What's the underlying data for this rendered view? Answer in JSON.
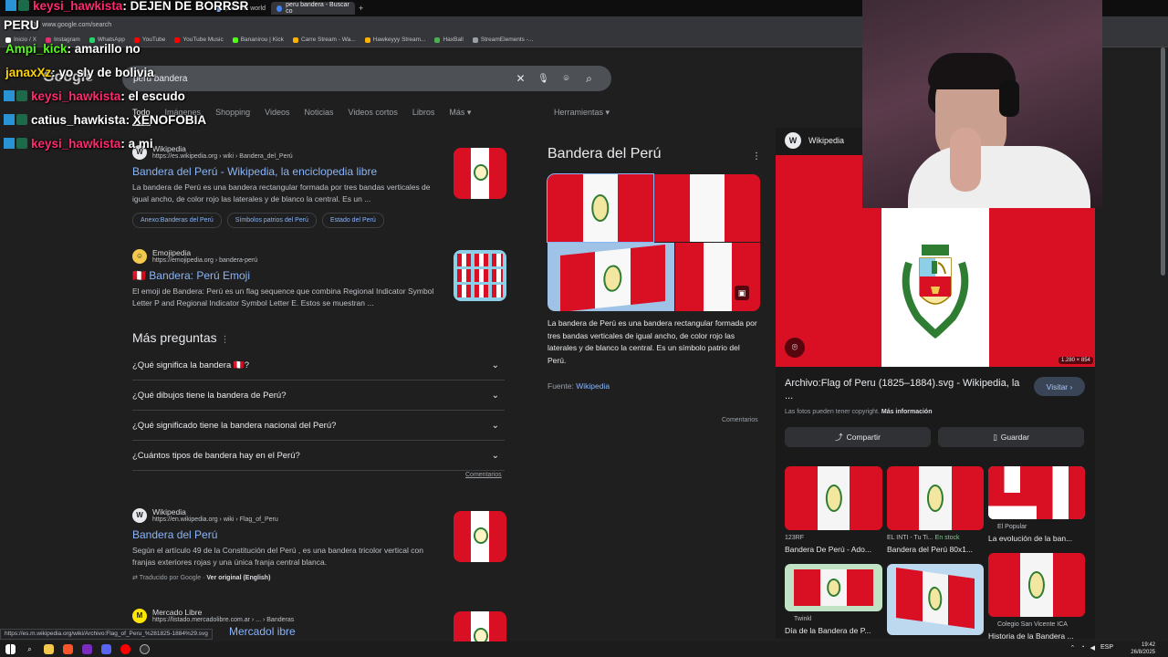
{
  "browser": {
    "tabs": [
      {
        "label": "print the world",
        "active": false
      },
      {
        "label": "peru bandera - Buscar co",
        "active": true
      }
    ],
    "new_tab": "+",
    "url": "www.google.com/search",
    "bookmarks": [
      {
        "label": "Inicio / X",
        "color": "#ffffff"
      },
      {
        "label": "Instagram",
        "color": "#e1306c"
      },
      {
        "label": "WhatsApp",
        "color": "#25d366"
      },
      {
        "label": "YouTube",
        "color": "#ff0000"
      },
      {
        "label": "YouTube Music",
        "color": "#ff0000"
      },
      {
        "label": "Bananirou | Kick",
        "color": "#53fc18"
      },
      {
        "label": "Carre Stream - Wa...",
        "color": "#ffb300"
      },
      {
        "label": "Hawkeyyy Stream...",
        "color": "#ffb300"
      },
      {
        "label": "HaxBall",
        "color": "#4caf50"
      },
      {
        "label": "StreamElements -...",
        "color": "#9aa0a6"
      }
    ]
  },
  "search": {
    "logo": "Google",
    "query": "peru bandera",
    "tabs": [
      "Todo",
      "Imágenes",
      "Shopping",
      "Videos",
      "Noticias",
      "Videos cortos",
      "Libros",
      "Más ▾"
    ],
    "tools": "Herramientas ▾"
  },
  "results": [
    {
      "source": "Wikipedia",
      "url": "https://es.wikipedia.org › wiki › Bandera_del_Perú",
      "title": "Bandera del Perú - Wikipedia, la enciclopedia libre",
      "snippet": "La bandera de Perú es una bandera rectangular formada por tres bandas verticales de igual ancho, de color rojo las laterales y de blanco la central. Es un ...",
      "chips": [
        "Anexo:Banderas del Perú",
        "Símbolos patrios del Perú",
        "Estado del Perú"
      ]
    },
    {
      "source": "Emojipedia",
      "url": "https://emojipedia.org › bandera-perú",
      "title": "🇵🇪 Bandera: Perú Emoji",
      "snippet": "El emoji de Bandera: Perú es un flag sequence que combina Regional Indicator Symbol Letter P and Regional Indicator Symbol Letter E. Estos se muestran ..."
    },
    {
      "source": "Wikipedia",
      "url": "https://en.wikipedia.org › wiki › Flag_of_Peru",
      "title": "Bandera del Perú",
      "snippet": "Según el artículo 49 de la Constitución del Perú , es una bandera tricolor vertical con franjas exteriores rojas y una única franja central blanca.",
      "translated": "Traducido por Google",
      "original": "Ver original (English)"
    },
    {
      "source": "Mercado Libre",
      "url": "https://listado.mercadolibre.com.ar › ... › Banderas",
      "title": "Mercadol ibre"
    }
  ],
  "faq": {
    "title": "Más preguntas",
    "items": [
      "¿Qué significa la bandera 🇵🇪?",
      "¿Qué dibujos tiene la bandera de Perú?",
      "¿Qué significado tiene la bandera nacional del Perú?",
      "¿Cuántos tipos de bandera hay en el Perú?"
    ],
    "feedback": "Comentarios"
  },
  "knowledge_panel": {
    "title": "Bandera del Perú",
    "description": "La bandera de Perú es una bandera rectangular formada por tres bandas verticales de igual ancho, de color rojo las laterales y de blanco la central. Es un símbolo patrio del Perú.",
    "source_label": "Fuente:",
    "source_link": "Wikipedia",
    "feedback": "Comentarios"
  },
  "viewer": {
    "site": "Wikipedia",
    "dimensions": "1.280 × 854",
    "title": "Archivo:Flag of Peru (1825–1884).svg - Wikipedia, la ...",
    "visit": "Visitar ›",
    "copyright": "Las fotos pueden tener copyright.",
    "more_info": "Más información",
    "share": "Compartir",
    "save": "Guardar",
    "related": [
      {
        "source": "123RF",
        "name": "Bandera De Perú - Ado..."
      },
      {
        "source": "EL INTI - Tu Ti...",
        "stock": "En stock",
        "name": "Bandera del Perú 80x1..."
      },
      {
        "source": "El Popular",
        "name": "La evolución de la ban..."
      },
      {
        "source": "Twinkl",
        "name": "Día de la Bandera de P..."
      },
      {
        "source": "",
        "name": ""
      },
      {
        "source": "Colegio San Vicente ICA",
        "name": "Historia de la Bandera ..."
      }
    ]
  },
  "chat_overlay": [
    {
      "user": "keysi_hawkista",
      "message": ": DEJEN DE BORRSR",
      "color": "#ff2a6d"
    },
    {
      "user": "PERU",
      "message": "",
      "color": "#ffffff"
    },
    {
      "user": "Ampi_kick",
      "message": ": amarillo no",
      "color": "#53fc18"
    },
    {
      "user": "janaxXz",
      "message": ": yo sly de bolivia",
      "color": "#ffd400"
    },
    {
      "user": "keysi_hawkista",
      "message": ": el escudo",
      "color": "#ff2a6d"
    },
    {
      "user": "catius_hawkista",
      "message": ": XENOFOBIA",
      "color": "#ffffff"
    },
    {
      "user": "keysi_hawkista",
      "message": ": a mi",
      "color": "#ff2a6d"
    }
  ],
  "status_url": "https://es.m.wikipedia.org/wiki/Archivo:Flag_of_Peru_%281825-1884%29.svg",
  "taskbar": {
    "tray": "ESP",
    "time": "19:42",
    "date": "26/8/2025"
  }
}
